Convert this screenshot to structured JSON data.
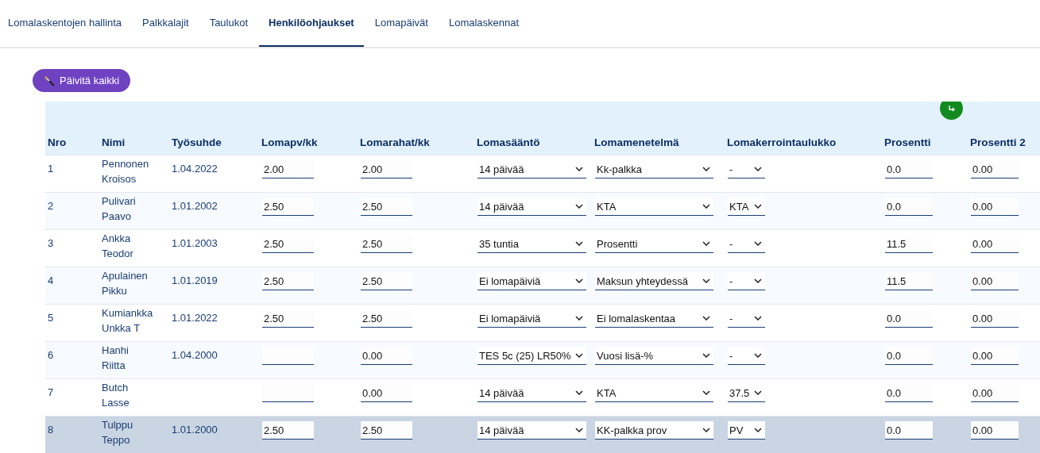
{
  "tabs": [
    {
      "label": "Lomalaskentojen hallinta",
      "selected": false
    },
    {
      "label": "Palkkalajit",
      "selected": false
    },
    {
      "label": "Taulukot",
      "selected": false
    },
    {
      "label": "Henkilöohjaukset",
      "selected": true
    },
    {
      "label": "Lomapäivät",
      "selected": false
    },
    {
      "label": "Lomalaskennat",
      "selected": false
    }
  ],
  "update_button": {
    "label": "Päivitä kaikki"
  },
  "table": {
    "columns": [
      "Nro",
      "Nimi",
      "Työsuhde",
      "Lomapv/kk",
      "Lomarahat/kk",
      "Lomasääntö",
      "Lomamenetelmä",
      "Lomakerrointaulukko",
      "Prosentti",
      "Prosentti 2"
    ],
    "rows": [
      {
        "nro": "1",
        "first": "Pennonen",
        "last": "Kroisos",
        "employment": "1.04.2022",
        "lomapv": "2.00",
        "lomarahat": "2.00",
        "rule": "14 päivää",
        "method": "Kk-palkka",
        "table": "-",
        "percent": "0.0",
        "percent2": "0.00",
        "selected": false
      },
      {
        "nro": "2",
        "first": "Pulivari",
        "last": "Paavo",
        "employment": "1.01.2002",
        "lomapv": "2.50",
        "lomarahat": "2.50",
        "rule": "14 päivää",
        "method": "KTA",
        "table": "KTA",
        "percent": "0.0",
        "percent2": "0.00",
        "selected": false
      },
      {
        "nro": "3",
        "first": "Ankka",
        "last": "Teodor",
        "employment": "1.01.2003",
        "lomapv": "2.50",
        "lomarahat": "2.50",
        "rule": "35 tuntia",
        "method": "Prosentti",
        "table": "-",
        "percent": "11.5",
        "percent2": "0.00",
        "selected": false
      },
      {
        "nro": "4",
        "first": "Apulainen",
        "last": "Pikku",
        "employment": "1.01.2019",
        "lomapv": "2.50",
        "lomarahat": "2.50",
        "rule": "Ei lomapäiviä",
        "method": "Maksun yhteydessä",
        "table": "-",
        "percent": "11.5",
        "percent2": "0.00",
        "selected": false
      },
      {
        "nro": "5",
        "first": "Kumiankka",
        "last": "Unkka T",
        "employment": "1.01.2022",
        "lomapv": "2.50",
        "lomarahat": "2.50",
        "rule": "Ei lomapäiviä",
        "method": "Ei lomalaskentaa",
        "table": "-",
        "percent": "0.0",
        "percent2": "0.00",
        "selected": false
      },
      {
        "nro": "6",
        "first": "Hanhi",
        "last": "Riitta",
        "employment": "1.04.2000",
        "lomarahat": "0.00",
        "rule": "TES 5c (25) LR50%",
        "method": "Vuosi lisä-%",
        "table": "-",
        "percent": "0.0",
        "percent2": "0.00",
        "selected": false
      },
      {
        "nro": "7",
        "first": "Butch",
        "last": "Lasse",
        "lomarahat": "0.00",
        "rule": "14 päivää",
        "method": "KTA",
        "table": "37.5",
        "percent": "0.0",
        "percent2": "0.00",
        "selected": false
      },
      {
        "nro": "8",
        "first": "Tulppu",
        "last": "Teppo",
        "employment": "1.01.2000",
        "lomapv": "2.50",
        "lomarahat": "2.50",
        "rule": "14 päivää",
        "method": "KK-palkka prov",
        "table": "PV",
        "percent": "0.0",
        "percent2": "0.00",
        "selected": true
      }
    ]
  }
}
